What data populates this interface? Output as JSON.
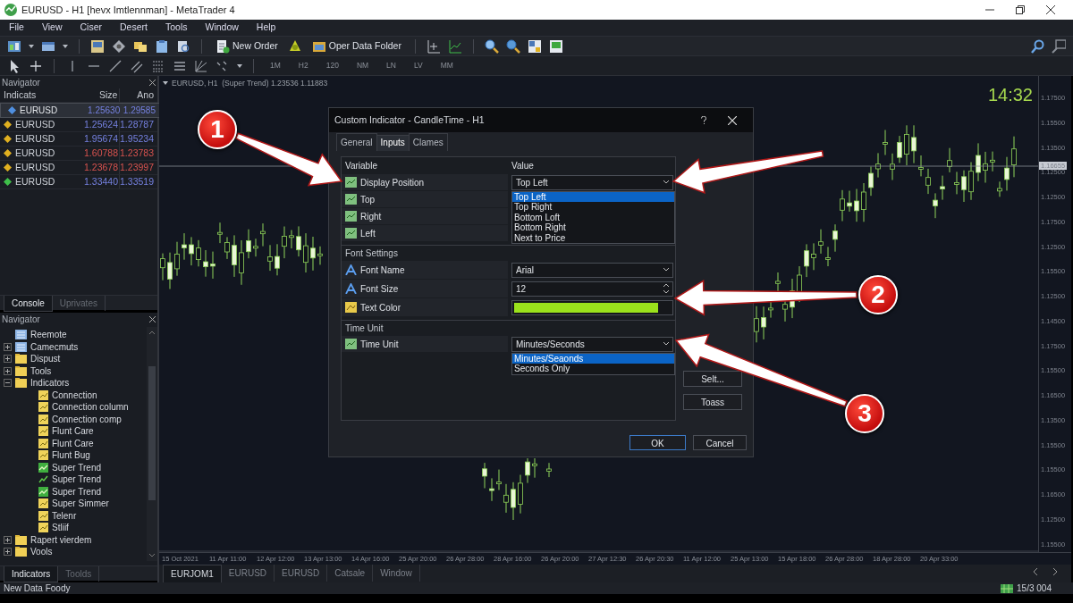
{
  "window": {
    "title": "EURUSD - H1 [hevx Imtlennman] - MetaTrader 4"
  },
  "menu": [
    "File",
    "View",
    "Ciser",
    "Desert",
    "Tools",
    "Window",
    "Help"
  ],
  "toolbar": {
    "buttons": [
      {
        "label": "New Order"
      },
      {
        "label": "Oper Data Folder"
      }
    ]
  },
  "timeframes": [
    "1M",
    "H2",
    "120",
    "NM",
    "LN",
    "LV",
    "MM"
  ],
  "market_watch": {
    "title": "Navigator",
    "columns": [
      "Indicats",
      "Size",
      "Ano"
    ],
    "rows": [
      {
        "symbol": "EURUSD",
        "color": "#4f8fe0",
        "bid": "1.25630",
        "ask": "1.29585",
        "falling": false,
        "selected": true
      },
      {
        "symbol": "EURUSD",
        "color": "#e0b020",
        "bid": "1.25624",
        "ask": "1.28787",
        "falling": false,
        "selected": false
      },
      {
        "symbol": "EURUSD",
        "color": "#e0b020",
        "bid": "1.95674",
        "ask": "1.95234",
        "falling": false,
        "selected": false
      },
      {
        "symbol": "EURUSD",
        "color": "#e0b020",
        "bid": "1.60788",
        "ask": "1.23783",
        "falling": true,
        "selected": false
      },
      {
        "symbol": "EURUSD",
        "color": "#e0b020",
        "bid": "1.23678",
        "ask": "1.23997",
        "falling": true,
        "selected": false
      },
      {
        "symbol": "EURUSD",
        "color": "#3fbf4a",
        "bid": "1.33440",
        "ask": "1.33519",
        "falling": false,
        "selected": false
      }
    ],
    "tabs": [
      {
        "label": "Console",
        "selected": true
      },
      {
        "label": "Uprivates",
        "selected": false
      }
    ]
  },
  "navigator": {
    "title": "Navigator",
    "items": [
      {
        "label": "Reemote",
        "kind": "list"
      },
      {
        "label": "Camecmuts",
        "kind": "list",
        "expanded": false
      },
      {
        "label": "Dispust",
        "kind": "folder",
        "expanded": false
      },
      {
        "label": "Tools",
        "kind": "folder",
        "expanded": false
      },
      {
        "label": "Indicators",
        "kind": "folder",
        "expanded": true,
        "children": [
          {
            "label": "Connection",
            "kind": "indicator"
          },
          {
            "label": "Connection column",
            "kind": "indicator"
          },
          {
            "label": "Connection comp",
            "kind": "indicator"
          },
          {
            "label": "Flunt Care",
            "kind": "indicator"
          },
          {
            "label": "Flunt Care",
            "kind": "indicator"
          },
          {
            "label": "Flunt Bug",
            "kind": "indicator"
          },
          {
            "label": "Super Trend",
            "kind": "trend"
          },
          {
            "label": "Super Trend",
            "kind": "trend-line"
          },
          {
            "label": "Super Trend",
            "kind": "trend"
          },
          {
            "label": "Super Simmer",
            "kind": "indicator"
          },
          {
            "label": "Telenr",
            "kind": "indicator"
          },
          {
            "label": "Stliif",
            "kind": "indicator"
          }
        ]
      },
      {
        "label": "Rapert vierdem",
        "kind": "folder",
        "expanded": false
      },
      {
        "label": "Vools",
        "kind": "folder",
        "expanded": false
      }
    ],
    "tabs": [
      {
        "label": "Indicators",
        "selected": true
      },
      {
        "label": "Toolds",
        "selected": false
      }
    ]
  },
  "chart": {
    "header": "EURUSD, H1  (Super Trend) 1.23536 1.11883",
    "clock": "14:32",
    "current_price": "1.16655",
    "price_labels": [
      "1.17500",
      "1.15500",
      "1.13500",
      "1.12500",
      "1.12500",
      "1.17500",
      "1.12500",
      "1.15500",
      "1.12500",
      "1.14500",
      "1.17500",
      "1.15500",
      "1.16500",
      "1.13500",
      "1.15500",
      "1.15500",
      "1.16500",
      "1.12500",
      "1.15500"
    ],
    "time_labels": [
      "15 Oct 2021",
      "11 Apr 11:00",
      "12 Apr 12:00",
      "13 Apr 13:00",
      "14 Apr 16:00",
      "25 Apr 20:00",
      "26 Apr 28:00",
      "28 Apr 16:00",
      "26 Apr 20:00",
      "27 Apr 12:30",
      "26 Apr 20:30",
      "11 Apr 12:00",
      "25 Apr 13:00",
      "15 Apr 18:00",
      "26 Apr 28:00",
      "18 Apr 28:00",
      "20 Apr 33:00"
    ],
    "tabs": [
      {
        "label": "EURJOM1",
        "selected": true
      },
      {
        "label": "EURUSD",
        "selected": false
      },
      {
        "label": "EURUSD",
        "selected": false
      },
      {
        "label": "Catsale",
        "selected": false
      },
      {
        "label": "Window",
        "selected": false
      }
    ]
  },
  "dialog": {
    "title": "Custom Indicator - CandleTime - H1",
    "tabs": [
      {
        "label": "General",
        "selected": false
      },
      {
        "label": "Inputs",
        "selected": true
      },
      {
        "label": "Clames",
        "selected": false
      }
    ],
    "columns": [
      "Variable",
      "Value"
    ],
    "sections": [
      {
        "rows": [
          {
            "label": "Display Position",
            "kind": "select",
            "value": "Top Left",
            "options": [
              {
                "label": "Top Left",
                "selected": true
              },
              {
                "label": "Top Right",
                "selected": false
              },
              {
                "label": "Bottom Loft",
                "selected": false
              },
              {
                "label": "Bottom Right",
                "selected": false
              },
              {
                "label": "Next to Price",
                "selected": false
              }
            ]
          },
          {
            "label": "Top",
            "kind": "hidden"
          },
          {
            "label": "Right",
            "kind": "hidden"
          },
          {
            "label": "Left",
            "kind": "hidden"
          }
        ]
      },
      {
        "heading": "Font Settings",
        "rows": [
          {
            "label": "Font Name",
            "kind": "select",
            "value": "Arial"
          },
          {
            "label": "Font Size",
            "kind": "spin",
            "value": "12"
          },
          {
            "label": "Text Color",
            "kind": "color",
            "color": "#9be21c"
          }
        ]
      },
      {
        "heading": "Time Unit",
        "rows": [
          {
            "label": "Time Unit",
            "kind": "select",
            "value": "Minutes/Seconds",
            "options": [
              {
                "label": "Minutes/Seaonds",
                "selected": true
              },
              {
                "label": "Seconds Only",
                "selected": false
              }
            ]
          }
        ]
      }
    ],
    "side_buttons": [
      "Selt...",
      "Toass"
    ],
    "buttons": [
      {
        "label": "OK",
        "default": true
      },
      {
        "label": "Cancel",
        "default": false
      }
    ]
  },
  "annotations": [
    "1",
    "2",
    "3"
  ],
  "status_bar": {
    "text": "New Data Foody",
    "connection": "15/3 004"
  }
}
